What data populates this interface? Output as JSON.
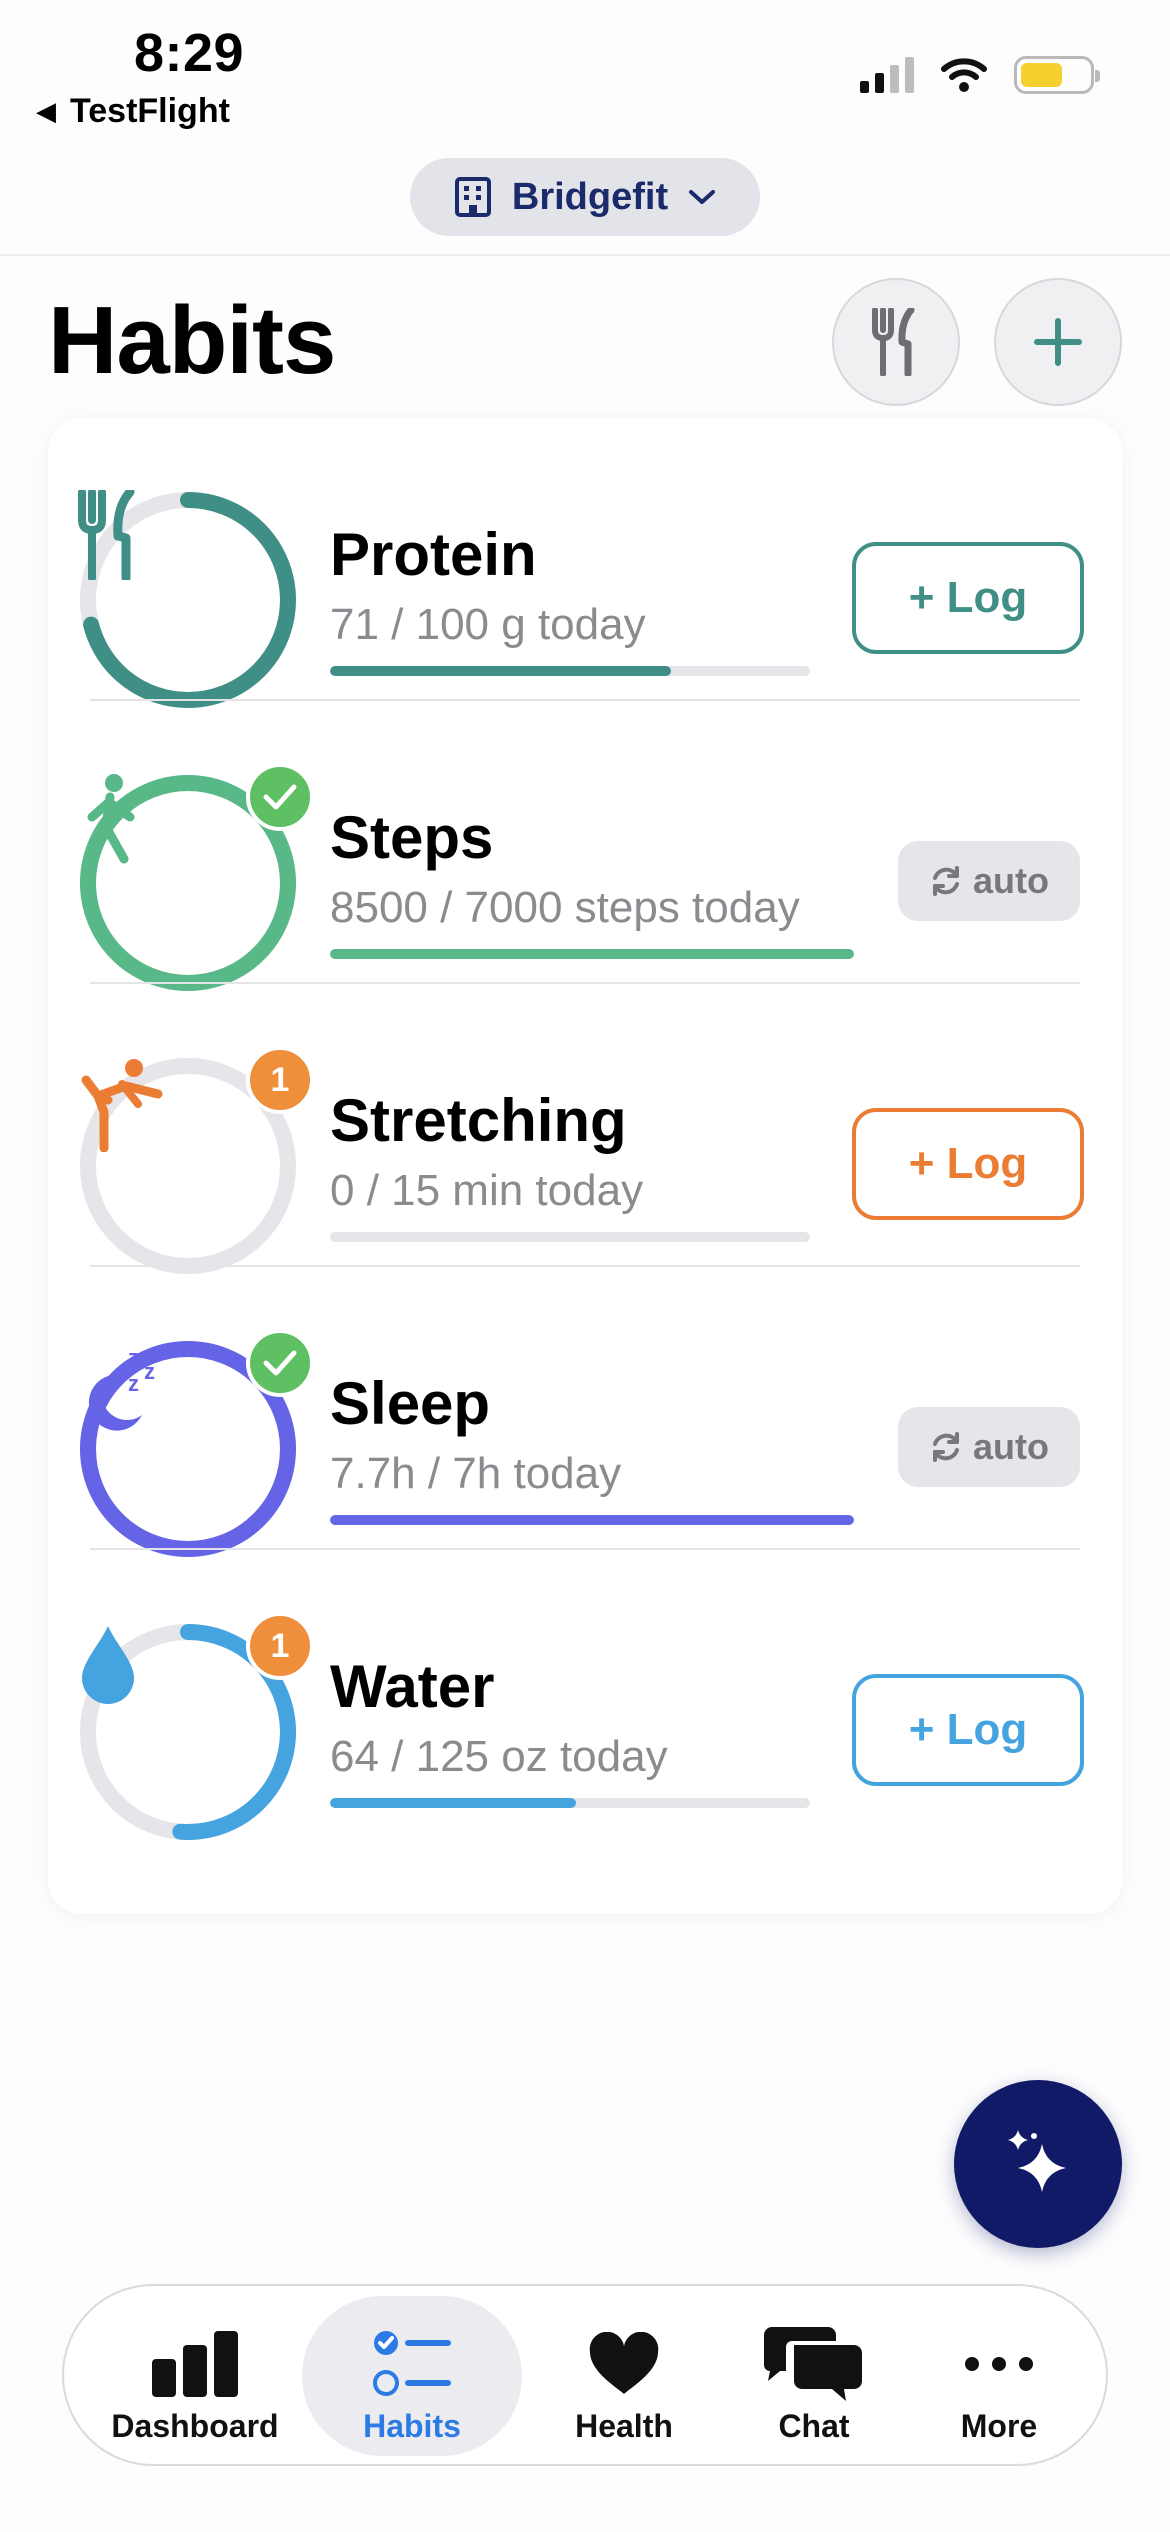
{
  "status_bar": {
    "time": "8:29",
    "back_app": "TestFlight"
  },
  "org_selector": {
    "label": "Bridgefit"
  },
  "page": {
    "title": "Habits"
  },
  "colors": {
    "protein": "#3f8f86",
    "steps": "#58b887",
    "stretching": "#ea7d33",
    "sleep": "#6664e6",
    "water": "#45a3e0",
    "fab": "#111a66",
    "active_tab": "#2c7be5"
  },
  "habits": [
    {
      "name": "Protein",
      "progress_text": "71 / 100 g today",
      "fraction": 0.71,
      "action": "+ Log",
      "icon": "fork-knife-icon",
      "badge": ""
    },
    {
      "name": "Steps",
      "progress_text": "8500 / 7000 steps today",
      "fraction": 1.0,
      "action": "auto",
      "icon": "walking-person-icon",
      "badge": "check"
    },
    {
      "name": "Stretching",
      "progress_text": "0 / 15 min today",
      "fraction": 0.0,
      "action": "+ Log",
      "icon": "stretching-person-icon",
      "badge": "1"
    },
    {
      "name": "Sleep",
      "progress_text": "7.7h / 7h today",
      "fraction": 1.0,
      "action": "auto",
      "icon": "moon-zzz-icon",
      "badge": "check"
    },
    {
      "name": "Water",
      "progress_text": "64 / 125 oz today",
      "fraction": 0.512,
      "action": "+ Log",
      "icon": "water-drop-icon",
      "badge": "1"
    }
  ],
  "tabs": [
    {
      "label": "Dashboard",
      "icon": "bar-chart-icon",
      "active": false
    },
    {
      "label": "Habits",
      "icon": "checklist-icon",
      "active": true
    },
    {
      "label": "Health",
      "icon": "heart-icon",
      "active": false
    },
    {
      "label": "Chat",
      "icon": "chat-bubbles-icon",
      "active": false
    },
    {
      "label": "More",
      "icon": "ellipsis-icon",
      "active": false
    }
  ]
}
